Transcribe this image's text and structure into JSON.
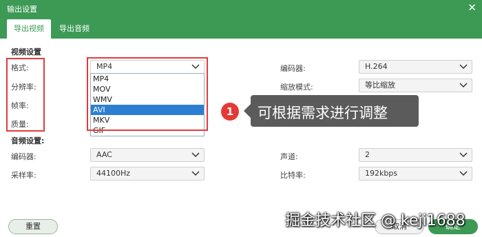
{
  "window": {
    "title": "输出设置",
    "close_glyph": "✕"
  },
  "tabs": [
    {
      "label": "导出视频",
      "active": true
    },
    {
      "label": "导出音频",
      "active": false
    }
  ],
  "video": {
    "section_title": "视频设置",
    "format": {
      "label": "格式:",
      "value": "MP4"
    },
    "resolution_label": "分辨率:",
    "framerate_label": "帧率:",
    "quality_label": "质量:",
    "encoder": {
      "label": "编码器:",
      "value": "H.264"
    },
    "scale_mode": {
      "label": "缩放模式:",
      "value": "等比缩放"
    }
  },
  "format_dropdown": {
    "options": [
      "MP4",
      "MOV",
      "WMV",
      "AVI",
      "MKV",
      "GIF"
    ],
    "highlighted": "AVI"
  },
  "audio": {
    "section_title": "音频设置:",
    "encoder": {
      "label": "编码器:",
      "value": "AAC"
    },
    "channel": {
      "label": "声道:",
      "value": "2"
    },
    "sample_rate": {
      "label": "采样率:",
      "value": "44100Hz"
    },
    "bitrate": {
      "label": "比特率:",
      "value": "192kbps"
    }
  },
  "annotation": {
    "badge": "1",
    "text": "可根据需求进行调整"
  },
  "buttons": {
    "reset": "重置",
    "cancel": "取消",
    "ok": "确定"
  },
  "watermark": "掘金技术社区 @ keji1688",
  "colors": {
    "accent": "#3c9a55",
    "highlight": "#2c7fd0",
    "annotation_red": "#e53935"
  }
}
